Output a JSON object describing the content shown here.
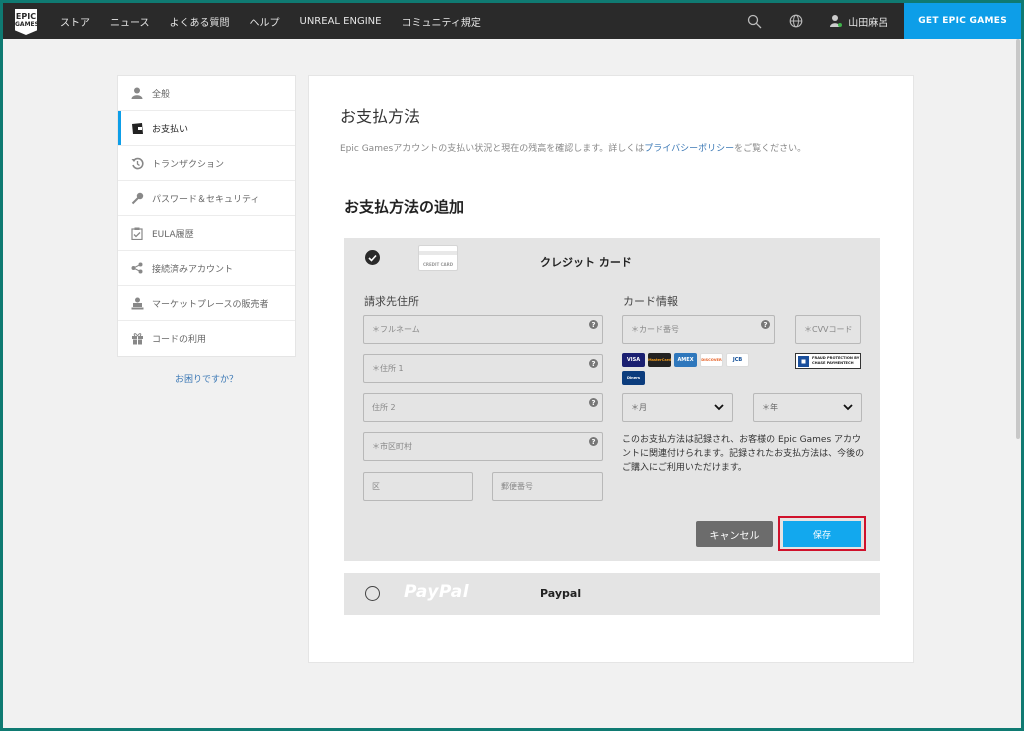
{
  "brand": {
    "logo_line1": "EPIC",
    "logo_line2": "GAMES"
  },
  "nav": {
    "links": [
      "ストア",
      "ニュース",
      "よくある質問",
      "ヘルプ",
      "UNREAL ENGINE",
      "コミュニティ規定"
    ],
    "user_name": "山田麻呂",
    "cta_label": "GET EPIC GAMES"
  },
  "sidebar": {
    "items": [
      {
        "label": "全般",
        "icon": "user-icon"
      },
      {
        "label": "お支払い",
        "icon": "wallet-icon",
        "active": true
      },
      {
        "label": "トランザクション",
        "icon": "history-icon"
      },
      {
        "label": "パスワード＆セキュリティ",
        "icon": "key-icon"
      },
      {
        "label": "EULA履歴",
        "icon": "clipboard-check-icon"
      },
      {
        "label": "接続済みアカウント",
        "icon": "share-icon"
      },
      {
        "label": "マーケットプレースの販売者",
        "icon": "seller-icon"
      },
      {
        "label": "コードの利用",
        "icon": "gift-icon"
      }
    ],
    "help_link": "お困りですか？"
  },
  "main": {
    "title": "お支払方法",
    "description_before": "Epic Gamesアカウントの支払い状況と現在の残高を確認します。詳しくは",
    "description_link": "プライバシーポリシー",
    "description_after": "をご覧ください。",
    "section_title": "お支払方法の追加"
  },
  "credit_card": {
    "title": "クレジット カード",
    "card_image_text": "CREDIT CARD",
    "billing_label": "請求先住所",
    "card_info_label": "カード情報",
    "placeholders": {
      "full_name": "＊フルネーム",
      "address1": "＊住所 1",
      "address2": "住所 2",
      "city": "＊市区町村",
      "ward": "区",
      "postal": "郵便番号",
      "card_number": "＊カード番号",
      "cvv": "＊CVVコード"
    },
    "month_select": "＊月",
    "year_select": "＊年",
    "brands": [
      "VISA",
      "MasterCard",
      "AMEX",
      "DISCOVER",
      "JCB",
      "Diners"
    ],
    "fraud_protection_line1": "FRAUD PROTECTION BY",
    "fraud_protection_line2": "CHASE PAYMENTECH",
    "note": "このお支払方法は記録され、お客様の Epic Games アカウントに関連付けられます。記録されたお支払方法は、今後のご購入にご利用いただけます。",
    "cancel_label": "キャンセル",
    "save_label": "保存"
  },
  "paypal": {
    "logo_text": "PayPal",
    "title": "Paypal"
  },
  "colors": {
    "accent": "#0d9ee8",
    "save_button": "#12a8ee",
    "highlight_outline": "#d0112b",
    "nav_bg": "#2a2a2a"
  }
}
